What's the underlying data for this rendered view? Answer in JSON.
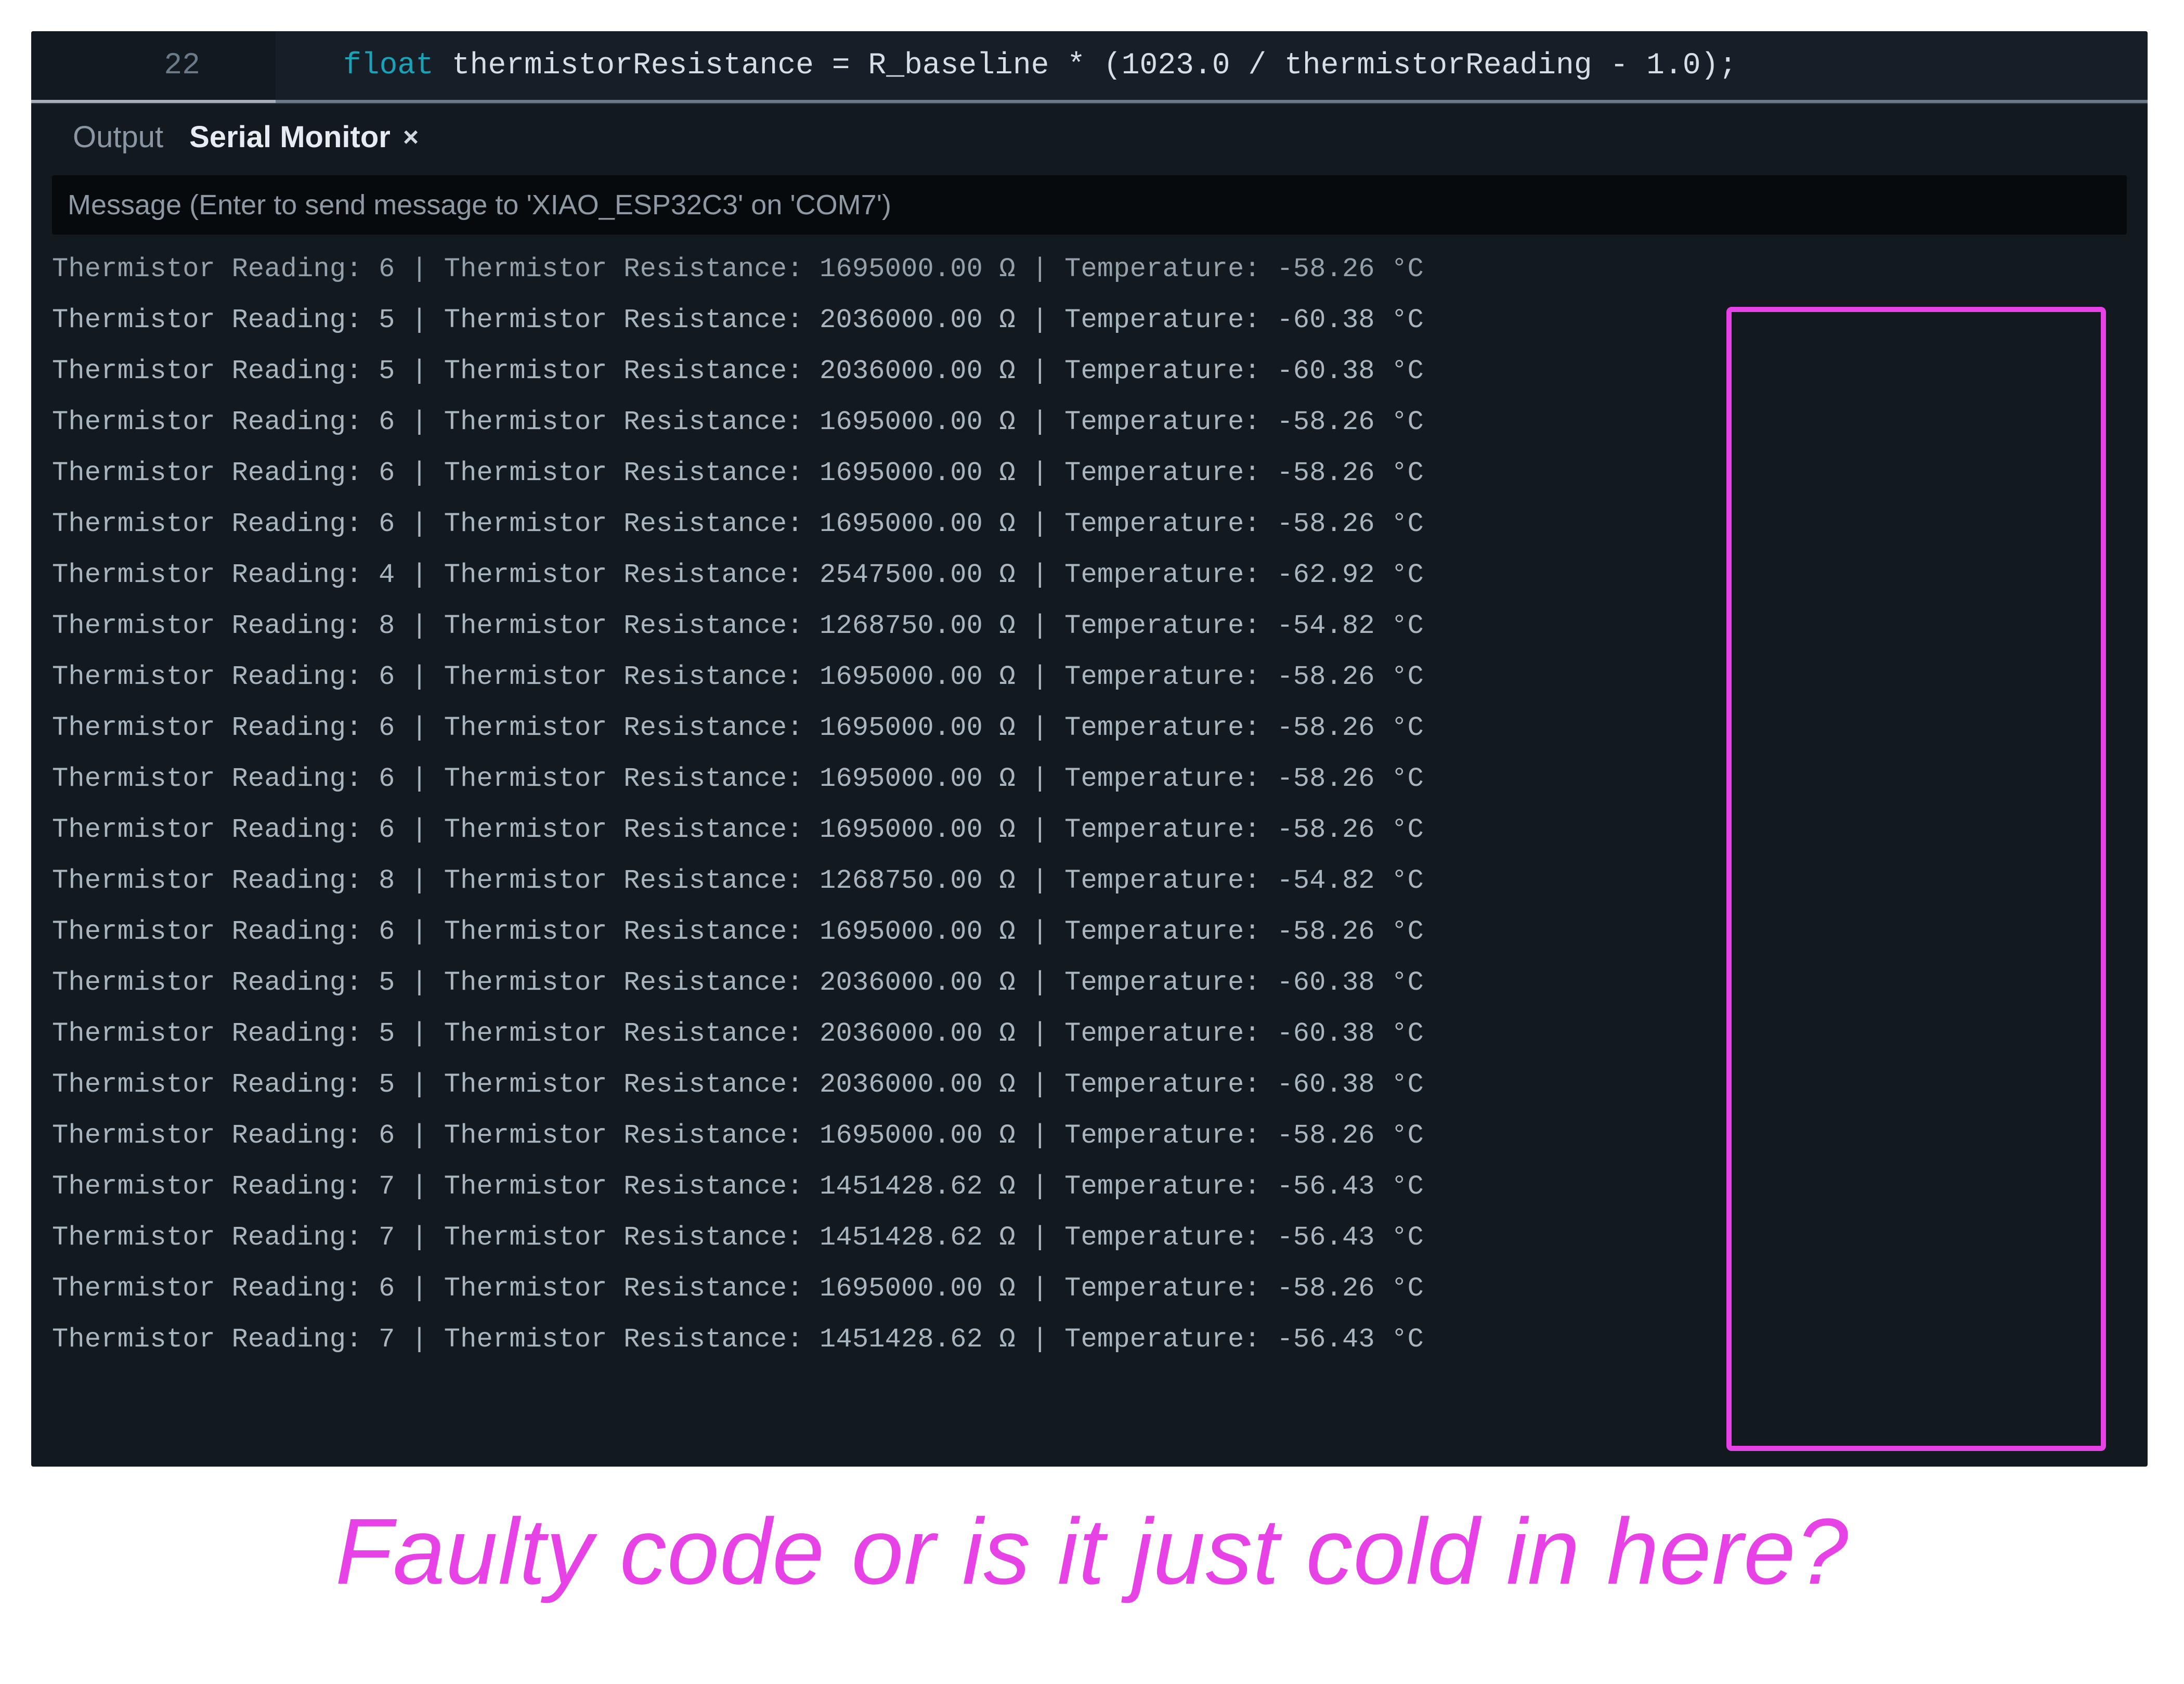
{
  "editor": {
    "line_number": "22",
    "kw_float": "float",
    "ident": " thermistorResistance ",
    "eq": "= ",
    "rbase": "R_baseline ",
    "star": "* ",
    "open": "(",
    "num1": "1023.0 ",
    "slash": "/ ",
    "reading": "thermistorReading ",
    "minus": "- ",
    "num2": "1.0",
    "close": ");"
  },
  "tabs": {
    "output": "Output",
    "serial": "Serial Monitor",
    "close_glyph": "×"
  },
  "msg": {
    "placeholder": "Message (Enter to send message to 'XIAO_ESP32C3' on 'COM7')"
  },
  "console_rows": [
    {
      "reading": "6",
      "resistance": "1695000.00",
      "temp": "-58.26",
      "first": true
    },
    {
      "reading": "5",
      "resistance": "2036000.00",
      "temp": "-60.38"
    },
    {
      "reading": "5",
      "resistance": "2036000.00",
      "temp": "-60.38"
    },
    {
      "reading": "6",
      "resistance": "1695000.00",
      "temp": "-58.26"
    },
    {
      "reading": "6",
      "resistance": "1695000.00",
      "temp": "-58.26"
    },
    {
      "reading": "6",
      "resistance": "1695000.00",
      "temp": "-58.26"
    },
    {
      "reading": "4",
      "resistance": "2547500.00",
      "temp": "-62.92"
    },
    {
      "reading": "8",
      "resistance": "1268750.00",
      "temp": "-54.82"
    },
    {
      "reading": "6",
      "resistance": "1695000.00",
      "temp": "-58.26"
    },
    {
      "reading": "6",
      "resistance": "1695000.00",
      "temp": "-58.26"
    },
    {
      "reading": "6",
      "resistance": "1695000.00",
      "temp": "-58.26"
    },
    {
      "reading": "6",
      "resistance": "1695000.00",
      "temp": "-58.26"
    },
    {
      "reading": "8",
      "resistance": "1268750.00",
      "temp": "-54.82"
    },
    {
      "reading": "6",
      "resistance": "1695000.00",
      "temp": "-58.26"
    },
    {
      "reading": "5",
      "resistance": "2036000.00",
      "temp": "-60.38"
    },
    {
      "reading": "5",
      "resistance": "2036000.00",
      "temp": "-60.38"
    },
    {
      "reading": "5",
      "resistance": "2036000.00",
      "temp": "-60.38"
    },
    {
      "reading": "6",
      "resistance": "1695000.00",
      "temp": "-58.26"
    },
    {
      "reading": "7",
      "resistance": "1451428.62",
      "temp": "-56.43"
    },
    {
      "reading": "7",
      "resistance": "1451428.62",
      "temp": "-56.43"
    },
    {
      "reading": "6",
      "resistance": "1695000.00",
      "temp": "-58.26"
    },
    {
      "reading": "7",
      "resistance": "1451428.62",
      "temp": "-56.43"
    }
  ],
  "labels": {
    "reading": "Thermistor Reading: ",
    "resistance": " | Thermistor Resistance: ",
    "ohm": " Ω",
    "temp": " | Temperature: ",
    "deg": " °C"
  },
  "caption": "Faulty code or is it just cold in here?",
  "colors": {
    "highlight": "#e642e6"
  }
}
